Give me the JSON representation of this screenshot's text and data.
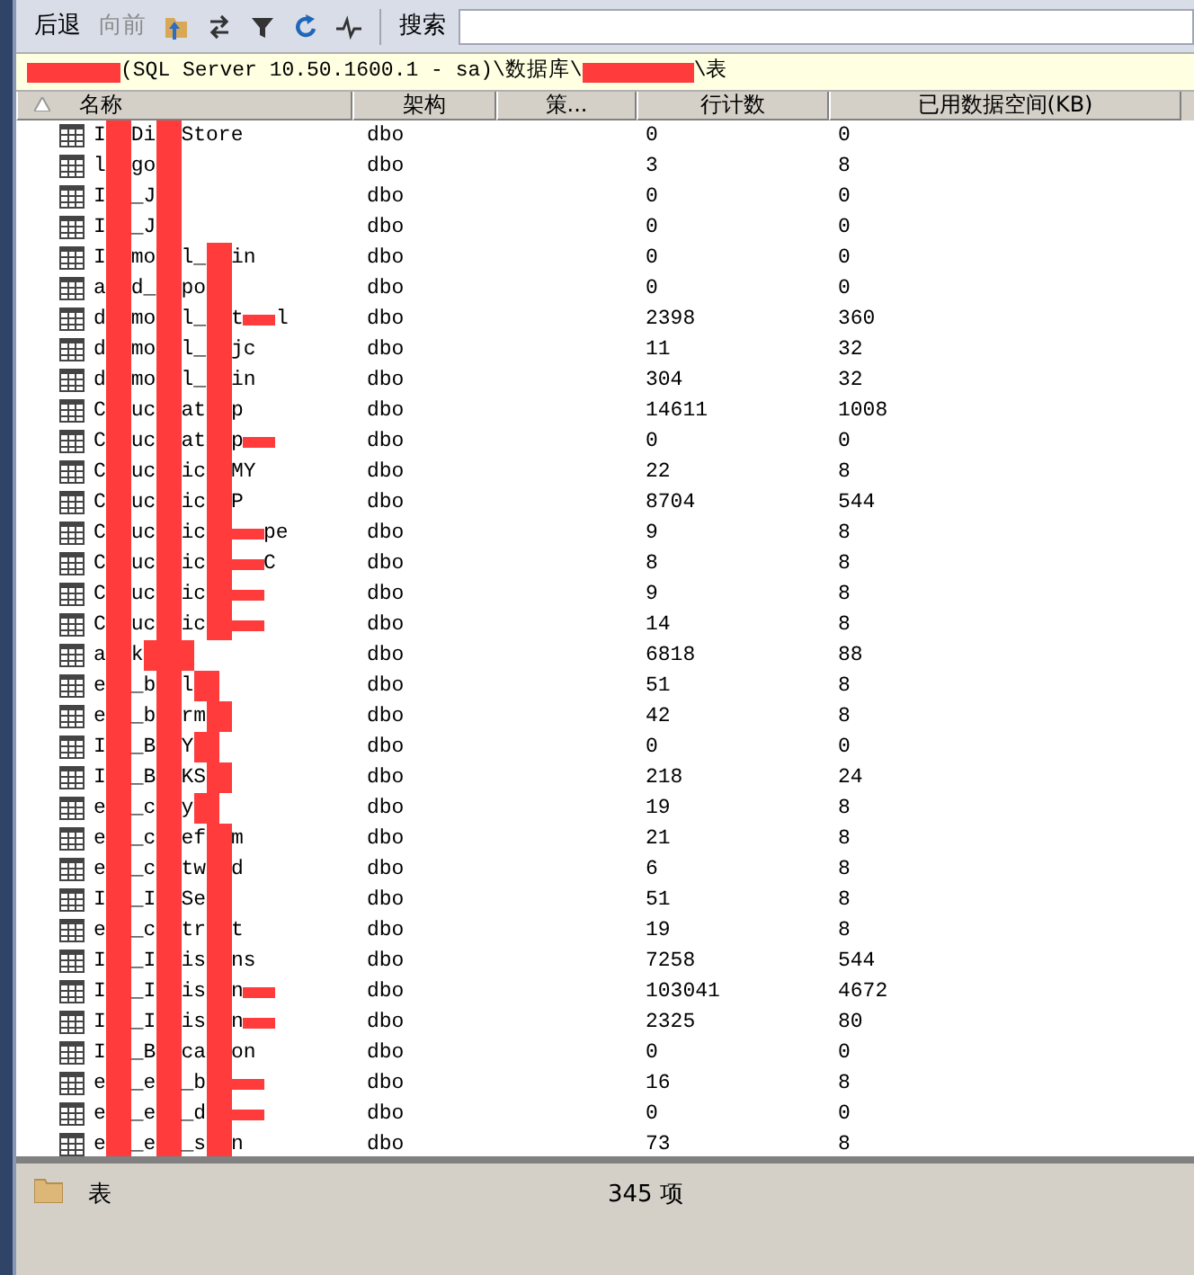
{
  "toolbar": {
    "buttons": [
      {
        "label": "后退",
        "disabled": false
      },
      {
        "label": "向前",
        "disabled": true
      }
    ],
    "search_label": "搜索"
  },
  "path": [
    {
      "kind": "mark"
    },
    {
      "kind": "text",
      "text": " (SQL Server 10.50.1600.1 - sa)\\数据库\\"
    },
    {
      "kind": "mark"
    },
    {
      "kind": "text",
      "text": "\\表"
    }
  ],
  "table": {
    "columns": [
      {
        "label": "名称",
        "sorted": true
      },
      {
        "label": "架构",
        "sorted": false
      },
      {
        "label": "策...",
        "sorted": false
      },
      {
        "label": "行计数",
        "sorted": false
      },
      {
        "label": "已用数据空间(KB)",
        "sorted": false
      }
    ],
    "rows": [
      {
        "name": [
          {
            "kind": "text",
            "text": "I"
          },
          {
            "kind": "bar"
          },
          {
            "kind": "text",
            "text": "Di"
          },
          {
            "kind": "bar"
          },
          {
            "kind": "text",
            "text": "Store"
          }
        ],
        "schema": "dbo",
        "rows": "0",
        "space": "0"
      },
      {
        "name": [
          {
            "kind": "text",
            "text": "l"
          },
          {
            "kind": "bar"
          },
          {
            "kind": "text",
            "text": "go"
          },
          {
            "kind": "bar"
          }
        ],
        "schema": "dbo",
        "rows": "3",
        "space": "8"
      },
      {
        "name": [
          {
            "kind": "text",
            "text": "I"
          },
          {
            "kind": "bar"
          },
          {
            "kind": "text",
            "text": "_J"
          },
          {
            "kind": "bar"
          }
        ],
        "schema": "dbo",
        "rows": "0",
        "space": "0"
      },
      {
        "name": [
          {
            "kind": "text",
            "text": "I"
          },
          {
            "kind": "bar"
          },
          {
            "kind": "text",
            "text": "_J"
          },
          {
            "kind": "bar"
          }
        ],
        "schema": "dbo",
        "rows": "0",
        "space": "0"
      },
      {
        "name": [
          {
            "kind": "text",
            "text": "I"
          },
          {
            "kind": "bar"
          },
          {
            "kind": "text",
            "text": "mo"
          },
          {
            "kind": "bar"
          },
          {
            "kind": "text",
            "text": "l_"
          },
          {
            "kind": "bar"
          },
          {
            "kind": "text",
            "text": "in"
          }
        ],
        "schema": "dbo",
        "rows": "0",
        "space": "0"
      },
      {
        "name": [
          {
            "kind": "text",
            "text": "a"
          },
          {
            "kind": "bar"
          },
          {
            "kind": "text",
            "text": "d_"
          },
          {
            "kind": "bar"
          },
          {
            "kind": "text",
            "text": "po"
          },
          {
            "kind": "bar"
          }
        ],
        "schema": "dbo",
        "rows": "0",
        "space": "0"
      },
      {
        "name": [
          {
            "kind": "text",
            "text": "d"
          },
          {
            "kind": "bar"
          },
          {
            "kind": "text",
            "text": "mo"
          },
          {
            "kind": "bar"
          },
          {
            "kind": "text",
            "text": "l_"
          },
          {
            "kind": "bar"
          },
          {
            "kind": "text",
            "text": "t"
          },
          {
            "kind": "mark"
          },
          {
            "kind": "text",
            "text": "l"
          }
        ],
        "schema": "dbo",
        "rows": "2398",
        "space": "360"
      },
      {
        "name": [
          {
            "kind": "text",
            "text": "d"
          },
          {
            "kind": "bar"
          },
          {
            "kind": "text",
            "text": "mo"
          },
          {
            "kind": "bar"
          },
          {
            "kind": "text",
            "text": "l_"
          },
          {
            "kind": "bar"
          },
          {
            "kind": "text",
            "text": "jc"
          }
        ],
        "schema": "dbo",
        "rows": "11",
        "space": "32"
      },
      {
        "name": [
          {
            "kind": "text",
            "text": "d"
          },
          {
            "kind": "bar"
          },
          {
            "kind": "text",
            "text": "mo"
          },
          {
            "kind": "bar"
          },
          {
            "kind": "text",
            "text": "l_"
          },
          {
            "kind": "bar"
          },
          {
            "kind": "text",
            "text": "in"
          }
        ],
        "schema": "dbo",
        "rows": "304",
        "space": "32"
      },
      {
        "name": [
          {
            "kind": "text",
            "text": "C"
          },
          {
            "kind": "bar"
          },
          {
            "kind": "text",
            "text": "uc"
          },
          {
            "kind": "bar"
          },
          {
            "kind": "text",
            "text": "at"
          },
          {
            "kind": "bar"
          },
          {
            "kind": "text",
            "text": "p"
          }
        ],
        "schema": "dbo",
        "rows": "14611",
        "space": "1008"
      },
      {
        "name": [
          {
            "kind": "text",
            "text": "C"
          },
          {
            "kind": "bar"
          },
          {
            "kind": "text",
            "text": "uc"
          },
          {
            "kind": "bar"
          },
          {
            "kind": "text",
            "text": "at"
          },
          {
            "kind": "bar"
          },
          {
            "kind": "text",
            "text": "p"
          },
          {
            "kind": "mark"
          }
        ],
        "schema": "dbo",
        "rows": "0",
        "space": "0"
      },
      {
        "name": [
          {
            "kind": "text",
            "text": "C"
          },
          {
            "kind": "bar"
          },
          {
            "kind": "text",
            "text": "uc"
          },
          {
            "kind": "bar"
          },
          {
            "kind": "text",
            "text": "ic"
          },
          {
            "kind": "bar"
          },
          {
            "kind": "text",
            "text": "MY"
          }
        ],
        "schema": "dbo",
        "rows": "22",
        "space": "8"
      },
      {
        "name": [
          {
            "kind": "text",
            "text": "C"
          },
          {
            "kind": "bar"
          },
          {
            "kind": "text",
            "text": "uc"
          },
          {
            "kind": "bar"
          },
          {
            "kind": "text",
            "text": "ic"
          },
          {
            "kind": "bar"
          },
          {
            "kind": "text",
            "text": "P"
          }
        ],
        "schema": "dbo",
        "rows": "8704",
        "space": "544"
      },
      {
        "name": [
          {
            "kind": "text",
            "text": "C"
          },
          {
            "kind": "bar"
          },
          {
            "kind": "text",
            "text": "uc"
          },
          {
            "kind": "bar"
          },
          {
            "kind": "text",
            "text": "ic"
          },
          {
            "kind": "bar"
          },
          {
            "kind": "mark"
          },
          {
            "kind": "text",
            "text": "pe"
          }
        ],
        "schema": "dbo",
        "rows": "9",
        "space": "8"
      },
      {
        "name": [
          {
            "kind": "text",
            "text": "C"
          },
          {
            "kind": "bar"
          },
          {
            "kind": "text",
            "text": "uc"
          },
          {
            "kind": "bar"
          },
          {
            "kind": "text",
            "text": "ic"
          },
          {
            "kind": "bar"
          },
          {
            "kind": "mark"
          },
          {
            "kind": "text",
            "text": "C"
          }
        ],
        "schema": "dbo",
        "rows": "8",
        "space": "8"
      },
      {
        "name": [
          {
            "kind": "text",
            "text": "C"
          },
          {
            "kind": "bar"
          },
          {
            "kind": "text",
            "text": "uc"
          },
          {
            "kind": "bar"
          },
          {
            "kind": "text",
            "text": "ic"
          },
          {
            "kind": "bar"
          },
          {
            "kind": "mark"
          }
        ],
        "schema": "dbo",
        "rows": "9",
        "space": "8"
      },
      {
        "name": [
          {
            "kind": "text",
            "text": "C"
          },
          {
            "kind": "bar"
          },
          {
            "kind": "text",
            "text": "uc"
          },
          {
            "kind": "bar"
          },
          {
            "kind": "text",
            "text": "ic"
          },
          {
            "kind": "bar"
          },
          {
            "kind": "mark"
          }
        ],
        "schema": "dbo",
        "rows": "14",
        "space": "8"
      },
      {
        "name": [
          {
            "kind": "text",
            "text": "a"
          },
          {
            "kind": "bar"
          },
          {
            "kind": "text",
            "text": "k"
          },
          {
            "kind": "bar"
          },
          {
            "kind": "bar"
          }
        ],
        "schema": "dbo",
        "rows": "6818",
        "space": "88"
      },
      {
        "name": [
          {
            "kind": "text",
            "text": "e"
          },
          {
            "kind": "bar"
          },
          {
            "kind": "text",
            "text": "_b"
          },
          {
            "kind": "bar"
          },
          {
            "kind": "text",
            "text": "l"
          },
          {
            "kind": "bar"
          }
        ],
        "schema": "dbo",
        "rows": "51",
        "space": "8"
      },
      {
        "name": [
          {
            "kind": "text",
            "text": "e"
          },
          {
            "kind": "bar"
          },
          {
            "kind": "text",
            "text": "_b"
          },
          {
            "kind": "bar"
          },
          {
            "kind": "text",
            "text": "rm"
          },
          {
            "kind": "bar"
          }
        ],
        "schema": "dbo",
        "rows": "42",
        "space": "8"
      },
      {
        "name": [
          {
            "kind": "text",
            "text": "I"
          },
          {
            "kind": "bar"
          },
          {
            "kind": "text",
            "text": "_B"
          },
          {
            "kind": "bar"
          },
          {
            "kind": "text",
            "text": "Y"
          },
          {
            "kind": "bar"
          }
        ],
        "schema": "dbo",
        "rows": "0",
        "space": "0"
      },
      {
        "name": [
          {
            "kind": "text",
            "text": "I"
          },
          {
            "kind": "bar"
          },
          {
            "kind": "text",
            "text": "_B"
          },
          {
            "kind": "bar"
          },
          {
            "kind": "text",
            "text": "KS"
          },
          {
            "kind": "bar"
          }
        ],
        "schema": "dbo",
        "rows": "218",
        "space": "24"
      },
      {
        "name": [
          {
            "kind": "text",
            "text": "e"
          },
          {
            "kind": "bar"
          },
          {
            "kind": "text",
            "text": "_c"
          },
          {
            "kind": "bar"
          },
          {
            "kind": "text",
            "text": "y"
          },
          {
            "kind": "bar"
          }
        ],
        "schema": "dbo",
        "rows": "19",
        "space": "8"
      },
      {
        "name": [
          {
            "kind": "text",
            "text": "e"
          },
          {
            "kind": "bar"
          },
          {
            "kind": "text",
            "text": "_c"
          },
          {
            "kind": "bar"
          },
          {
            "kind": "text",
            "text": "ef"
          },
          {
            "kind": "bar"
          },
          {
            "kind": "text",
            "text": "m"
          }
        ],
        "schema": "dbo",
        "rows": "21",
        "space": "8"
      },
      {
        "name": [
          {
            "kind": "text",
            "text": "e"
          },
          {
            "kind": "bar"
          },
          {
            "kind": "text",
            "text": "_c"
          },
          {
            "kind": "bar"
          },
          {
            "kind": "text",
            "text": "tw"
          },
          {
            "kind": "bar"
          },
          {
            "kind": "text",
            "text": "d"
          }
        ],
        "schema": "dbo",
        "rows": "6",
        "space": "8"
      },
      {
        "name": [
          {
            "kind": "text",
            "text": "I"
          },
          {
            "kind": "bar"
          },
          {
            "kind": "text",
            "text": "_I"
          },
          {
            "kind": "bar"
          },
          {
            "kind": "text",
            "text": "Se"
          },
          {
            "kind": "bar"
          }
        ],
        "schema": "dbo",
        "rows": "51",
        "space": "8"
      },
      {
        "name": [
          {
            "kind": "text",
            "text": "e"
          },
          {
            "kind": "bar"
          },
          {
            "kind": "text",
            "text": "_c"
          },
          {
            "kind": "bar"
          },
          {
            "kind": "text",
            "text": "tr"
          },
          {
            "kind": "bar"
          },
          {
            "kind": "text",
            "text": "t"
          }
        ],
        "schema": "dbo",
        "rows": "19",
        "space": "8"
      },
      {
        "name": [
          {
            "kind": "text",
            "text": "I"
          },
          {
            "kind": "bar"
          },
          {
            "kind": "text",
            "text": "_I"
          },
          {
            "kind": "bar"
          },
          {
            "kind": "text",
            "text": "is"
          },
          {
            "kind": "bar"
          },
          {
            "kind": "text",
            "text": "ns"
          }
        ],
        "schema": "dbo",
        "rows": "7258",
        "space": "544"
      },
      {
        "name": [
          {
            "kind": "text",
            "text": "I"
          },
          {
            "kind": "bar"
          },
          {
            "kind": "text",
            "text": "_I"
          },
          {
            "kind": "bar"
          },
          {
            "kind": "text",
            "text": "is"
          },
          {
            "kind": "bar"
          },
          {
            "kind": "text",
            "text": "n"
          },
          {
            "kind": "mark"
          }
        ],
        "schema": "dbo",
        "rows": "103041",
        "space": "4672"
      },
      {
        "name": [
          {
            "kind": "text",
            "text": "I"
          },
          {
            "kind": "bar"
          },
          {
            "kind": "text",
            "text": "_I"
          },
          {
            "kind": "bar"
          },
          {
            "kind": "text",
            "text": "is"
          },
          {
            "kind": "bar"
          },
          {
            "kind": "text",
            "text": "n"
          },
          {
            "kind": "mark"
          }
        ],
        "schema": "dbo",
        "rows": "2325",
        "space": "80"
      },
      {
        "name": [
          {
            "kind": "text",
            "text": "I"
          },
          {
            "kind": "bar"
          },
          {
            "kind": "text",
            "text": "_B"
          },
          {
            "kind": "bar"
          },
          {
            "kind": "text",
            "text": "ca"
          },
          {
            "kind": "bar"
          },
          {
            "kind": "text",
            "text": "on"
          }
        ],
        "schema": "dbo",
        "rows": "0",
        "space": "0"
      },
      {
        "name": [
          {
            "kind": "text",
            "text": "e"
          },
          {
            "kind": "bar"
          },
          {
            "kind": "text",
            "text": "_e"
          },
          {
            "kind": "bar"
          },
          {
            "kind": "text",
            "text": "_b"
          },
          {
            "kind": "bar"
          },
          {
            "kind": "mark"
          }
        ],
        "schema": "dbo",
        "rows": "16",
        "space": "8"
      },
      {
        "name": [
          {
            "kind": "text",
            "text": "e"
          },
          {
            "kind": "bar"
          },
          {
            "kind": "text",
            "text": "_e"
          },
          {
            "kind": "bar"
          },
          {
            "kind": "text",
            "text": "_d"
          },
          {
            "kind": "bar"
          },
          {
            "kind": "mark"
          }
        ],
        "schema": "dbo",
        "rows": "0",
        "space": "0"
      },
      {
        "name": [
          {
            "kind": "text",
            "text": "e"
          },
          {
            "kind": "bar"
          },
          {
            "kind": "text",
            "text": "_e"
          },
          {
            "kind": "bar"
          },
          {
            "kind": "text",
            "text": "_s"
          },
          {
            "kind": "bar"
          },
          {
            "kind": "text",
            "text": "n"
          }
        ],
        "schema": "dbo",
        "rows": "73",
        "space": "8"
      }
    ]
  },
  "status_bar": {
    "folder": "表",
    "count": "345 项"
  }
}
